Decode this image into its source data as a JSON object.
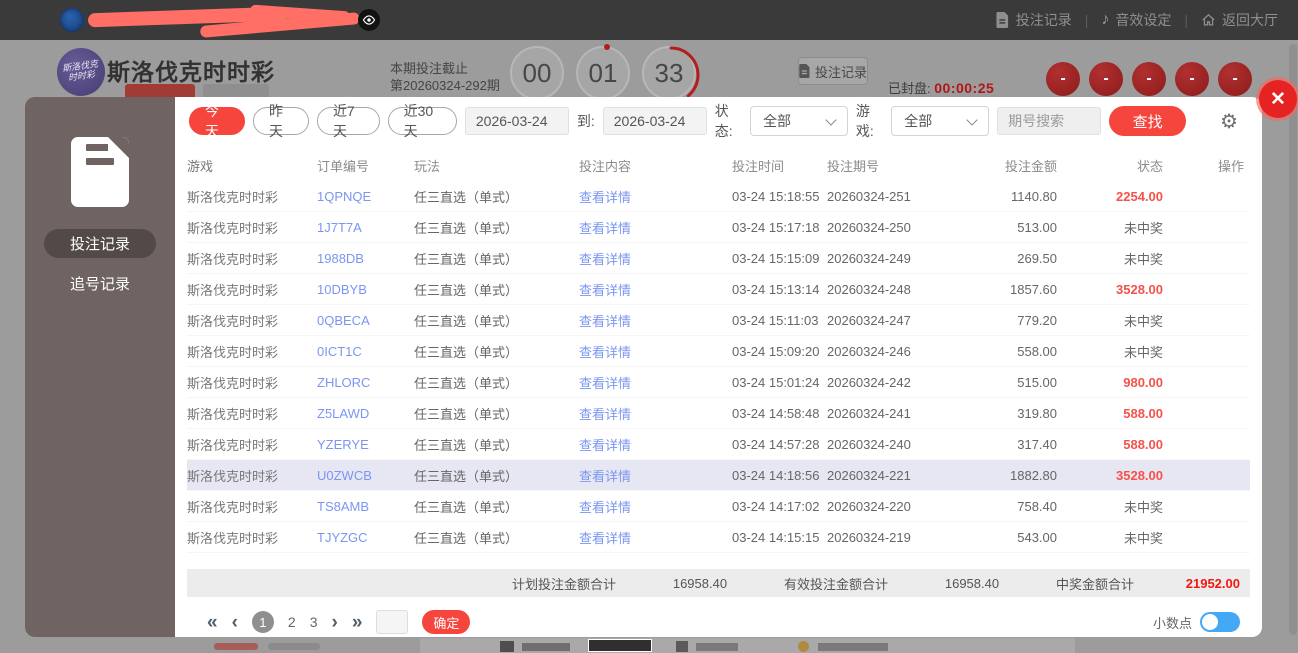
{
  "topbar": {
    "menu": [
      {
        "label": "投注记录",
        "icon": "document-icon"
      },
      {
        "label": "音效设定",
        "icon": "music-note-icon"
      },
      {
        "label": "返回大厅",
        "icon": "home-icon"
      }
    ]
  },
  "icons": {
    "gear": "⚙",
    "music": "♪",
    "close": "✕",
    "refresh": "⟳"
  },
  "header": {
    "title": "斯洛伐克时时彩",
    "logo": {
      "line1": "斯洛伐克",
      "line2": "时时彩"
    },
    "deadline_label": "本期投注截止",
    "period_text": "第20260324-292期",
    "countdown": {
      "h": "00",
      "m": "01",
      "s": "33"
    },
    "bet_record_button": "投注记录",
    "closed_label": "已封盘:",
    "closed_time": "00:00:25",
    "balls": [
      "-",
      "-",
      "-",
      "-",
      "-"
    ]
  },
  "sidebar": {
    "items": [
      {
        "label": "投注记录",
        "active": true
      },
      {
        "label": "追号记录",
        "active": false
      }
    ]
  },
  "filters": {
    "quick": [
      {
        "label": "今天",
        "active": true
      },
      {
        "label": "昨天",
        "active": false
      },
      {
        "label": "近7天",
        "active": false
      },
      {
        "label": "近30天",
        "active": false
      }
    ],
    "date_from": "2026-03-24",
    "to_label": "到:",
    "date_to": "2026-03-24",
    "status_label": "状态:",
    "status_value": "全部",
    "game_label": "游戏:",
    "game_value": "全部",
    "search_placeholder": "期号搜索",
    "search_button": "查找"
  },
  "table": {
    "columns": [
      "游戏",
      "订单编号",
      "玩法",
      "投注内容",
      "投注时间",
      "投注期号",
      "投注金额",
      "状态",
      "操作"
    ],
    "rows": [
      {
        "game": "斯洛伐克时时彩",
        "order": "1QPNQE",
        "play": "任三直选（单式）",
        "content": "查看详情",
        "time": "03-24 15:18:55",
        "period": "20260324-251",
        "amount": "1140.80",
        "status": "2254.00",
        "won": true
      },
      {
        "game": "斯洛伐克时时彩",
        "order": "1J7T7A",
        "play": "任三直选（单式）",
        "content": "查看详情",
        "time": "03-24 15:17:18",
        "period": "20260324-250",
        "amount": "513.00",
        "status": "未中奖",
        "won": false
      },
      {
        "game": "斯洛伐克时时彩",
        "order": "1988DB",
        "play": "任三直选（单式）",
        "content": "查看详情",
        "time": "03-24 15:15:09",
        "period": "20260324-249",
        "amount": "269.50",
        "status": "未中奖",
        "won": false
      },
      {
        "game": "斯洛伐克时时彩",
        "order": "10DBYB",
        "play": "任三直选（单式）",
        "content": "查看详情",
        "time": "03-24 15:13:14",
        "period": "20260324-248",
        "amount": "1857.60",
        "status": "3528.00",
        "won": true
      },
      {
        "game": "斯洛伐克时时彩",
        "order": "0QBECA",
        "play": "任三直选（单式）",
        "content": "查看详情",
        "time": "03-24 15:11:03",
        "period": "20260324-247",
        "amount": "779.20",
        "status": "未中奖",
        "won": false
      },
      {
        "game": "斯洛伐克时时彩",
        "order": "0ICT1C",
        "play": "任三直选（单式）",
        "content": "查看详情",
        "time": "03-24 15:09:20",
        "period": "20260324-246",
        "amount": "558.00",
        "status": "未中奖",
        "won": false
      },
      {
        "game": "斯洛伐克时时彩",
        "order": "ZHLORC",
        "play": "任三直选（单式）",
        "content": "查看详情",
        "time": "03-24 15:01:24",
        "period": "20260324-242",
        "amount": "515.00",
        "status": "980.00",
        "won": true
      },
      {
        "game": "斯洛伐克时时彩",
        "order": "Z5LAWD",
        "play": "任三直选（单式）",
        "content": "查看详情",
        "time": "03-24 14:58:48",
        "period": "20260324-241",
        "amount": "319.80",
        "status": "588.00",
        "won": true
      },
      {
        "game": "斯洛伐克时时彩",
        "order": "YZERYE",
        "play": "任三直选（单式）",
        "content": "查看详情",
        "time": "03-24 14:57:28",
        "period": "20260324-240",
        "amount": "317.40",
        "status": "588.00",
        "won": true
      },
      {
        "game": "斯洛伐克时时彩",
        "order": "U0ZWCB",
        "play": "任三直选（单式）",
        "content": "查看详情",
        "time": "03-24 14:18:56",
        "period": "20260324-221",
        "amount": "1882.80",
        "status": "3528.00",
        "won": true,
        "highlight": true
      },
      {
        "game": "斯洛伐克时时彩",
        "order": "TS8AMB",
        "play": "任三直选（单式）",
        "content": "查看详情",
        "time": "03-24 14:17:02",
        "period": "20260324-220",
        "amount": "758.40",
        "status": "未中奖",
        "won": false
      },
      {
        "game": "斯洛伐克时时彩",
        "order": "TJYZGC",
        "play": "任三直选（单式）",
        "content": "查看详情",
        "time": "03-24 14:15:15",
        "period": "20260324-219",
        "amount": "543.00",
        "status": "未中奖",
        "won": false
      }
    ],
    "summary": {
      "planned_label": "计划投注金额合计",
      "planned_value": "16958.40",
      "valid_label": "有效投注金额合计",
      "valid_value": "16958.40",
      "win_label": "中奖金额合计",
      "win_value": "21952.00"
    }
  },
  "pagination": {
    "first": "«",
    "prev": "‹",
    "next": "›",
    "last": "»",
    "pages": [
      "1",
      "2",
      "3"
    ],
    "current": "1",
    "jump_value": "",
    "confirm": "确定",
    "decimal_label": "小数点"
  },
  "colors": {
    "accent_red": "#f5453d",
    "link_blue": "#7b96f2",
    "win_red": "#f4524a",
    "toggle_blue": "#45a8f5",
    "sidebar_bg": "#6f6462",
    "close_red": "#e62222"
  }
}
